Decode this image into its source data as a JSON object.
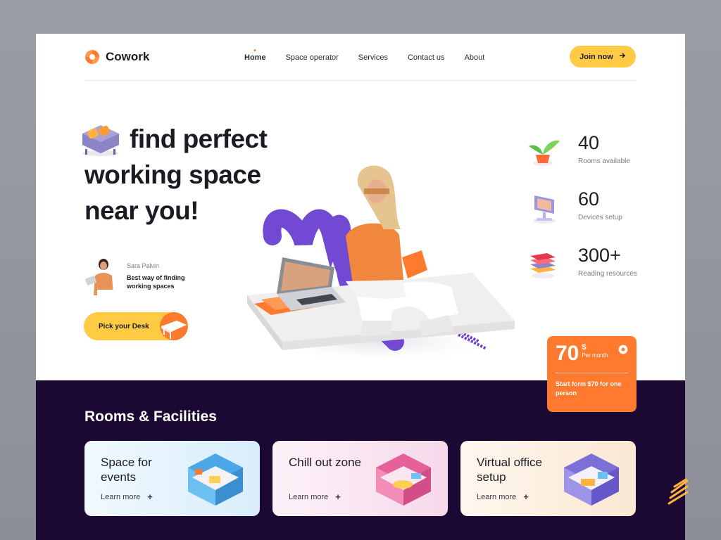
{
  "brand": {
    "name": "Cowork",
    "accent": "#ff7a2f",
    "yellow": "#ffcb45",
    "dark": "#1c0933"
  },
  "nav": {
    "items": [
      {
        "label": "Home",
        "active": true
      },
      {
        "label": "Space operator",
        "active": false
      },
      {
        "label": "Services",
        "active": false
      },
      {
        "label": "Contact us",
        "active": false
      },
      {
        "label": "About",
        "active": false
      }
    ],
    "cta_label": "Join now",
    "cta_icon": "arrow-right-icon"
  },
  "hero": {
    "title_line1": "find perfect",
    "title_line2": "working space",
    "title_line3": "near you!",
    "testimonial": {
      "name": "Sara Palvin",
      "text": "Best way of finding working spaces"
    },
    "cta_label": "Pick your Desk"
  },
  "stats": [
    {
      "value": "40",
      "label": "Rooms available",
      "icon": "plant-icon"
    },
    {
      "value": "60",
      "label": "Devices setup",
      "icon": "computer-icon"
    },
    {
      "value": "300+",
      "label": "Reading resources",
      "icon": "books-icon"
    }
  ],
  "pricing": {
    "amount": "70",
    "currency": "$",
    "period": "Per month",
    "description": "Start form $70 for one person"
  },
  "facilities": {
    "title": "Rooms & Facilities",
    "cards": [
      {
        "title": "Space for events",
        "more": "Learn more",
        "bg": "#eaf5fc"
      },
      {
        "title": "Chill out zone",
        "more": "Learn more",
        "bg": "#fbecf4"
      },
      {
        "title": "Virtual office setup",
        "more": "Learn more",
        "bg": "#fdf3e8"
      }
    ]
  }
}
